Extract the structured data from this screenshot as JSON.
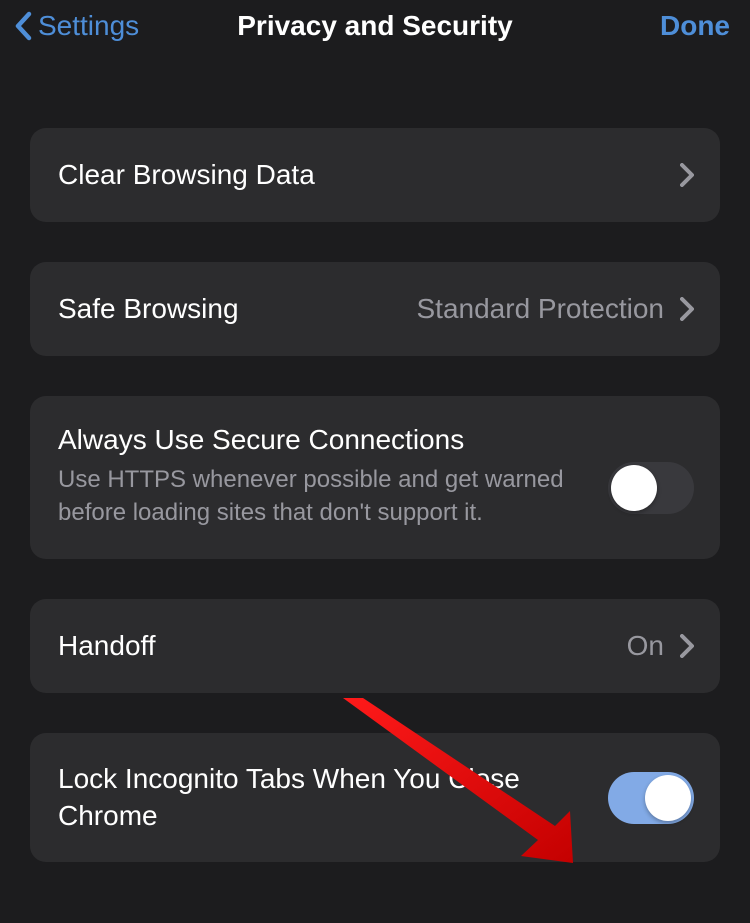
{
  "header": {
    "back_label": "Settings",
    "title": "Privacy and Security",
    "done_label": "Done"
  },
  "rows": {
    "clear": {
      "label": "Clear Browsing Data"
    },
    "safe": {
      "label": "Safe Browsing",
      "value": "Standard Protection"
    },
    "secure": {
      "label": "Always Use Secure Connections",
      "subtitle": "Use HTTPS whenever possible and get warned before loading sites that don't support it."
    },
    "handoff": {
      "label": "Handoff",
      "value": "On"
    },
    "lock": {
      "label": "Lock Incognito Tabs When You Close Chrome"
    }
  },
  "annotation": {
    "arrow_color": "#e51c23"
  }
}
